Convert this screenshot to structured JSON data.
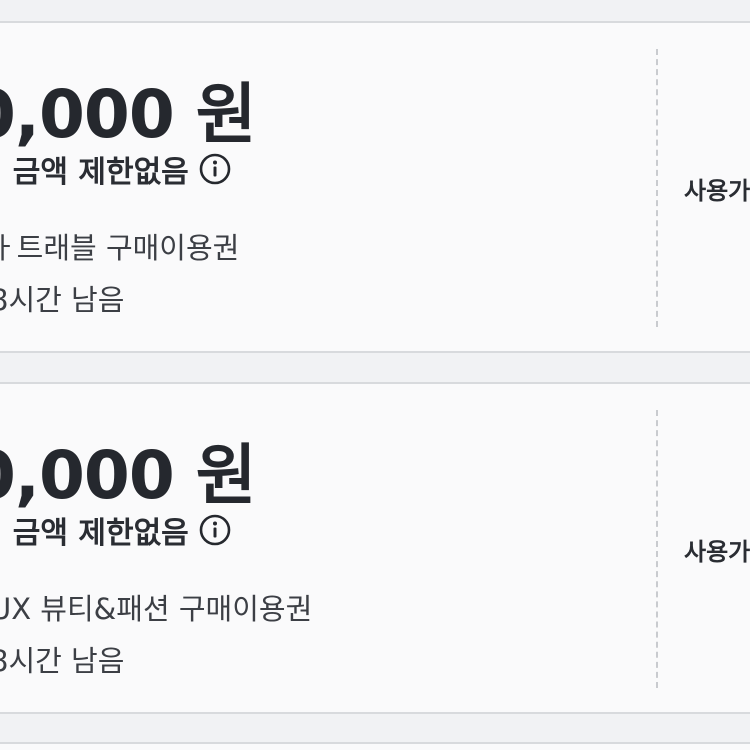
{
  "coupons": [
    {
      "amount": "0,000 원",
      "condition": "l 금액 제한없음",
      "name": "ㅏ트래블 구매이용권",
      "remaining": "8시간 남음",
      "action_label": "사용가"
    },
    {
      "amount": "0,000 원",
      "condition": "l 금액 제한없음",
      "name": "UX 뷰티&패션 구매이용권",
      "remaining": "8시간 남음",
      "action_label": "사용가"
    }
  ],
  "icons": {
    "info": "info-circle-icon"
  },
  "colors": {
    "background": "#f1f2f4",
    "card": "#fafafb",
    "text": "#24272d",
    "border": "#d8dadd"
  }
}
